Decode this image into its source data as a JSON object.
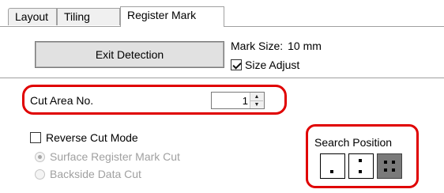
{
  "tabs": [
    {
      "label": "Layout",
      "active": false
    },
    {
      "label": "Tiling",
      "active": false
    },
    {
      "label": "Register Mark",
      "active": true
    }
  ],
  "exit_button": {
    "label": "Exit Detection"
  },
  "mark_size": {
    "label": "Mark Size:",
    "value": "10 mm"
  },
  "size_adjust": {
    "label": "Size Adjust",
    "checked": true
  },
  "cut_area": {
    "label": "Cut Area No.",
    "value": "1"
  },
  "reverse_cut": {
    "label": "Reverse Cut Mode",
    "checked": false
  },
  "radio_options": [
    {
      "label": "Surface Register Mark Cut",
      "selected": true,
      "enabled": false
    },
    {
      "label": "Backside Data Cut",
      "selected": false,
      "enabled": false
    }
  ],
  "search_position": {
    "label": "Search Position",
    "options": [
      "one-dot",
      "two-dots",
      "four-dots"
    ],
    "selected": "four-dots"
  },
  "highlight_color": "#e00000"
}
